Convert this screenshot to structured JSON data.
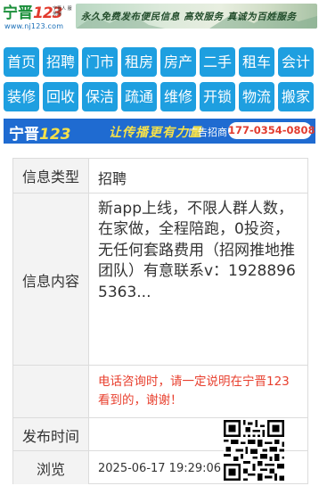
{
  "header": {
    "logo_name": "宁晋",
    "logo_number": "123",
    "logo_slogan": "宁晋人 服务网",
    "logo_url": "www.nj123.com",
    "banner_text": "永久免费发布便民信息 高效服务 真诚为百姓服务"
  },
  "nav": {
    "items": [
      {
        "label": "首页"
      },
      {
        "label": "招聘"
      },
      {
        "label": "门市"
      },
      {
        "label": "租房"
      },
      {
        "label": "房产"
      },
      {
        "label": "二手"
      },
      {
        "label": "租车"
      },
      {
        "label": "会计"
      },
      {
        "label": "装修"
      },
      {
        "label": "回收"
      },
      {
        "label": "保洁"
      },
      {
        "label": "疏通"
      },
      {
        "label": "维修"
      },
      {
        "label": "开锁"
      },
      {
        "label": "物流"
      },
      {
        "label": "搬家"
      }
    ],
    "color": "#1e9fe0"
  },
  "ad": {
    "brand": "宁晋",
    "brand_number": "123",
    "slogan": "让传播更有力量",
    "label": "广告招商",
    "phone": "177-0354-0808",
    "background": "#1f6bd1"
  },
  "info": {
    "type_label": "信息类型",
    "type_value": "招聘",
    "content_label": "信息内容",
    "content_text": "新app上线，不限人群人数，在家做，全程陪跑，0投资，无任何套路费用（招网推地推团队）有意联系v：19288965363...",
    "notice": "电话咨询时，请一定说明在宁晋123看到的，谢谢！",
    "publish_label": "发布时间",
    "views_label": "浏览",
    "publish_time": "2025-06-17 19:29:06",
    "notice_color": "#e8402f"
  }
}
